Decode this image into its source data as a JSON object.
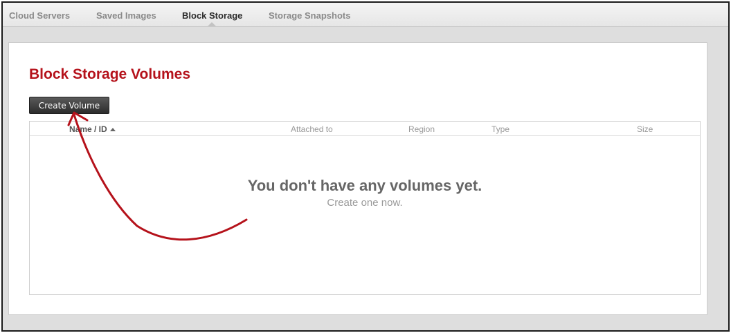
{
  "tabs": [
    {
      "label": "Cloud Servers",
      "active": false
    },
    {
      "label": "Saved Images",
      "active": false
    },
    {
      "label": "Block Storage",
      "active": true
    },
    {
      "label": "Storage Snapshots",
      "active": false
    }
  ],
  "page": {
    "title": "Block Storage Volumes",
    "create_button_label": "Create Volume"
  },
  "table": {
    "columns": [
      "Name / ID",
      "Attached to",
      "Region",
      "Type",
      "Size"
    ],
    "sorted_column": "Name / ID",
    "sort_direction": "ascending"
  },
  "empty_state": {
    "title": "You don't have any volumes yet.",
    "link": "Create one now."
  },
  "colors": {
    "title_red": "#b5121b",
    "annotation_red": "#b5121b",
    "button_dark": "#2c2c2c"
  },
  "icons": {
    "sort_indicator": "sort-ascending-icon",
    "annotation": "curved-arrow-icon"
  }
}
